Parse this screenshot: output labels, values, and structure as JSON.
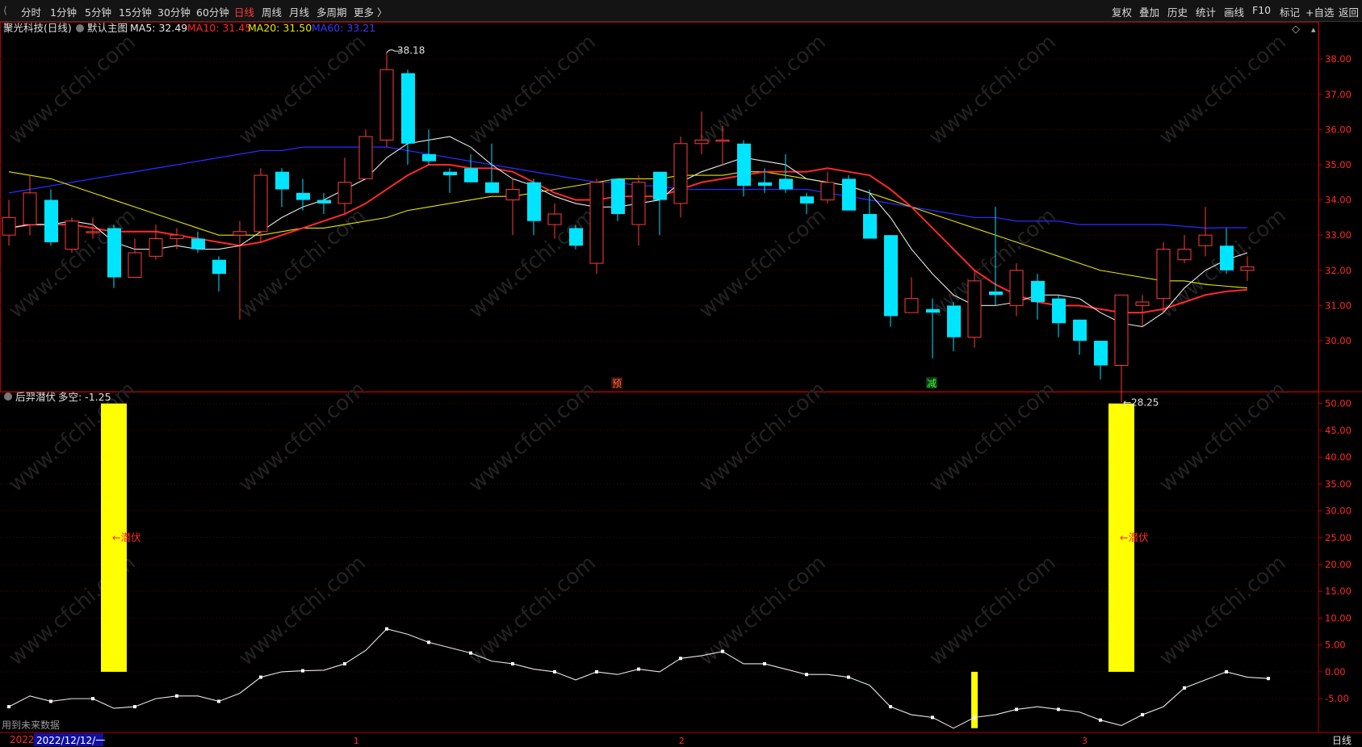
{
  "topbar": {
    "back_label": "⟨",
    "periods": [
      "分时",
      "1分钟",
      "5分钟",
      "15分钟",
      "30分钟",
      "60分钟",
      "日线",
      "周线",
      "月线",
      "多周期",
      "更多 〉"
    ],
    "active_period": "日线",
    "tools": [
      "复权",
      "叠加",
      "历史",
      "统计",
      "画线",
      "F10",
      "+自选",
      "返回"
    ],
    "tools_extra": "标记"
  },
  "colors": {
    "up": "#ff3b3b",
    "down": "#00e5ff",
    "ma5": "#e8e8e8",
    "ma10": "#ff2a2a",
    "ma20": "#e6e600",
    "ma60": "#2a2aff",
    "signal": "#ffff00",
    "grid": "#5a0000",
    "axis": "#b00000"
  },
  "main_panel": {
    "stock_name": "聚光科技(日线)",
    "template_label": "默认主图",
    "ma5_label": "MA5: 32.49",
    "ma10_label": "MA10: 31.45",
    "ma20_label": "MA20: 31.50",
    "ma60_label": "MA60: 33.21",
    "high_label": "38.18",
    "low_label": "←28.25",
    "marker_yu": "预",
    "marker_jian": "减",
    "diamond_icon": "◇"
  },
  "sub_panel": {
    "indicator_label": "后羿潜伏",
    "value_label": "多空: -1.25",
    "signal_text_1": "←潜伏",
    "signal_text_2": "←潜伏",
    "footer_note": "用到未来数据"
  },
  "xaxis": {
    "cursor_date": "2022/12/12/一",
    "left_clip": "2022",
    "month_labels": [
      "1",
      "2",
      "3"
    ],
    "period_button": "日线"
  },
  "chart_data": [
    {
      "type": "candlestick",
      "ylim": [
        28.6,
        38.6
      ],
      "y_ticks": [
        30.0,
        31.0,
        32.0,
        33.0,
        34.0,
        35.0,
        36.0,
        37.0,
        38.0
      ],
      "candles": [
        {
          "o": 33.0,
          "c": 33.5,
          "h": 34.0,
          "l": 32.7
        },
        {
          "o": 33.3,
          "c": 34.2,
          "h": 34.7,
          "l": 33.0
        },
        {
          "o": 34.0,
          "c": 32.8,
          "h": 34.3,
          "l": 32.7
        },
        {
          "o": 32.6,
          "c": 33.4,
          "h": 33.5,
          "l": 32.5
        },
        {
          "o": 33.1,
          "c": 33.1,
          "h": 33.5,
          "l": 32.9
        },
        {
          "o": 33.2,
          "c": 31.8,
          "h": 33.3,
          "l": 31.5
        },
        {
          "o": 31.8,
          "c": 32.5,
          "h": 32.9,
          "l": 31.8
        },
        {
          "o": 32.4,
          "c": 32.9,
          "h": 33.3,
          "l": 32.3
        },
        {
          "o": 32.9,
          "c": 33.0,
          "h": 33.2,
          "l": 32.6
        },
        {
          "o": 32.9,
          "c": 32.6,
          "h": 33.1,
          "l": 32.5
        },
        {
          "o": 32.3,
          "c": 31.9,
          "h": 32.4,
          "l": 31.4
        },
        {
          "o": 33.0,
          "c": 33.1,
          "h": 33.4,
          "l": 30.6
        },
        {
          "o": 33.1,
          "c": 34.7,
          "h": 34.9,
          "l": 32.8
        },
        {
          "o": 34.8,
          "c": 34.3,
          "h": 34.9,
          "l": 33.8
        },
        {
          "o": 34.2,
          "c": 34.0,
          "h": 34.6,
          "l": 33.7
        },
        {
          "o": 34.0,
          "c": 33.9,
          "h": 34.2,
          "l": 33.6
        },
        {
          "o": 33.9,
          "c": 34.5,
          "h": 35.2,
          "l": 33.6
        },
        {
          "o": 34.6,
          "c": 35.8,
          "h": 36.0,
          "l": 34.6
        },
        {
          "o": 35.7,
          "c": 37.7,
          "h": 38.2,
          "l": 35.5
        },
        {
          "o": 37.6,
          "c": 35.6,
          "h": 37.7,
          "l": 35.0
        },
        {
          "o": 35.3,
          "c": 35.1,
          "h": 36.0,
          "l": 35.0
        },
        {
          "o": 34.8,
          "c": 34.7,
          "h": 34.9,
          "l": 34.2
        },
        {
          "o": 34.9,
          "c": 34.5,
          "h": 35.3,
          "l": 34.5
        },
        {
          "o": 34.5,
          "c": 34.2,
          "h": 35.6,
          "l": 34.2
        },
        {
          "o": 34.0,
          "c": 34.3,
          "h": 34.6,
          "l": 33.0
        },
        {
          "o": 34.5,
          "c": 33.4,
          "h": 34.6,
          "l": 33.0
        },
        {
          "o": 33.3,
          "c": 33.6,
          "h": 33.9,
          "l": 32.9
        },
        {
          "o": 33.2,
          "c": 32.7,
          "h": 33.3,
          "l": 32.6
        },
        {
          "o": 32.2,
          "c": 34.5,
          "h": 34.6,
          "l": 31.9
        },
        {
          "o": 34.6,
          "c": 33.6,
          "h": 34.6,
          "l": 33.4
        },
        {
          "o": 33.3,
          "c": 34.5,
          "h": 34.7,
          "l": 32.7
        },
        {
          "o": 34.8,
          "c": 34.0,
          "h": 34.8,
          "l": 33.0
        },
        {
          "o": 33.9,
          "c": 35.6,
          "h": 35.8,
          "l": 33.5
        },
        {
          "o": 35.6,
          "c": 35.7,
          "h": 36.5,
          "l": 35.3
        },
        {
          "o": 35.7,
          "c": 35.7,
          "h": 36.1,
          "l": 35.0
        },
        {
          "o": 35.6,
          "c": 34.4,
          "h": 35.7,
          "l": 34.1
        },
        {
          "o": 34.5,
          "c": 34.4,
          "h": 34.9,
          "l": 34.2
        },
        {
          "o": 34.6,
          "c": 34.3,
          "h": 35.3,
          "l": 34.2
        },
        {
          "o": 34.1,
          "c": 33.9,
          "h": 34.2,
          "l": 33.6
        },
        {
          "o": 34.0,
          "c": 34.5,
          "h": 34.8,
          "l": 33.9
        },
        {
          "o": 34.6,
          "c": 33.7,
          "h": 34.7,
          "l": 33.7
        },
        {
          "o": 33.6,
          "c": 32.9,
          "h": 34.3,
          "l": 32.9
        },
        {
          "o": 33.0,
          "c": 30.7,
          "h": 33.0,
          "l": 30.4
        },
        {
          "o": 30.8,
          "c": 31.2,
          "h": 31.8,
          "l": 30.9
        },
        {
          "o": 30.9,
          "c": 30.8,
          "h": 31.2,
          "l": 29.5
        },
        {
          "o": 31.0,
          "c": 30.1,
          "h": 31.1,
          "l": 29.7
        },
        {
          "o": 30.1,
          "c": 31.7,
          "h": 32.0,
          "l": 29.8
        },
        {
          "o": 31.4,
          "c": 31.3,
          "h": 33.8,
          "l": 31.0
        },
        {
          "o": 31.0,
          "c": 32.0,
          "h": 32.2,
          "l": 30.7
        },
        {
          "o": 31.7,
          "c": 31.1,
          "h": 31.9,
          "l": 30.6
        },
        {
          "o": 31.2,
          "c": 30.5,
          "h": 31.3,
          "l": 30.1
        },
        {
          "o": 30.6,
          "c": 30.0,
          "h": 30.6,
          "l": 29.6
        },
        {
          "o": 30.0,
          "c": 29.3,
          "h": 30.0,
          "l": 28.9
        },
        {
          "o": 29.3,
          "c": 31.3,
          "h": 31.3,
          "l": 28.25
        },
        {
          "o": 31.0,
          "c": 31.1,
          "h": 31.3,
          "l": 30.4
        },
        {
          "o": 31.2,
          "c": 32.6,
          "h": 32.8,
          "l": 30.8
        },
        {
          "o": 32.3,
          "c": 32.6,
          "h": 33.0,
          "l": 32.2
        },
        {
          "o": 32.7,
          "c": 33.0,
          "h": 33.8,
          "l": 32.4
        },
        {
          "o": 32.7,
          "c": 32.0,
          "h": 33.2,
          "l": 31.9
        },
        {
          "o": 32.0,
          "c": 32.1,
          "h": 32.4,
          "l": 31.7
        }
      ],
      "ma5": [
        33.2,
        33.3,
        33.3,
        33.4,
        33.3,
        32.8,
        32.6,
        32.6,
        32.7,
        32.6,
        32.6,
        32.7,
        33.1,
        33.5,
        33.8,
        34.0,
        34.3,
        34.6,
        35.2,
        35.6,
        35.7,
        35.8,
        35.5,
        35.0,
        34.6,
        34.4,
        34.1,
        33.9,
        33.8,
        33.8,
        33.9,
        34.0,
        34.5,
        34.8,
        35.0,
        35.2,
        35.1,
        35.0,
        34.6,
        34.5,
        34.4,
        34.2,
        33.5,
        32.6,
        31.9,
        31.3,
        31.0,
        31.0,
        31.1,
        31.3,
        31.3,
        31.2,
        30.8,
        30.5,
        30.4,
        30.8,
        31.5,
        32.0,
        32.3,
        32.5
      ],
      "ma10": [
        33.2,
        33.3,
        33.3,
        33.3,
        33.2,
        33.1,
        33.1,
        33.1,
        33.0,
        32.9,
        32.8,
        32.7,
        32.8,
        33.0,
        33.2,
        33.4,
        33.6,
        33.9,
        34.3,
        34.7,
        35.0,
        35.0,
        34.9,
        34.9,
        34.8,
        34.5,
        34.2,
        34.0,
        34.0,
        34.1,
        34.1,
        34.1,
        34.3,
        34.5,
        34.6,
        34.7,
        34.8,
        34.8,
        34.8,
        34.9,
        34.8,
        34.7,
        34.3,
        33.8,
        33.2,
        32.6,
        32.0,
        31.6,
        31.3,
        31.1,
        31.0,
        31.0,
        30.9,
        30.8,
        30.8,
        30.9,
        31.1,
        31.3,
        31.4,
        31.45
      ],
      "ma20": [
        34.8,
        34.7,
        34.6,
        34.4,
        34.2,
        34.0,
        33.8,
        33.6,
        33.4,
        33.2,
        33.0,
        33.0,
        33.0,
        33.1,
        33.2,
        33.2,
        33.3,
        33.4,
        33.5,
        33.7,
        33.8,
        33.9,
        34.0,
        34.1,
        34.1,
        34.2,
        34.3,
        34.4,
        34.5,
        34.6,
        34.6,
        34.6,
        34.7,
        34.7,
        34.7,
        34.8,
        34.8,
        34.7,
        34.6,
        34.5,
        34.4,
        34.2,
        34.0,
        33.8,
        33.6,
        33.4,
        33.2,
        33.0,
        32.8,
        32.6,
        32.4,
        32.2,
        32.0,
        31.9,
        31.8,
        31.7,
        31.7,
        31.6,
        31.55,
        31.5
      ],
      "ma60": [
        34.2,
        34.3,
        34.4,
        34.5,
        34.6,
        34.7,
        34.8,
        34.9,
        35.0,
        35.1,
        35.2,
        35.3,
        35.4,
        35.4,
        35.5,
        35.5,
        35.5,
        35.5,
        35.5,
        35.4,
        35.3,
        35.2,
        35.1,
        35.0,
        34.9,
        34.8,
        34.7,
        34.6,
        34.5,
        34.5,
        34.4,
        34.4,
        34.3,
        34.3,
        34.3,
        34.3,
        34.3,
        34.3,
        34.3,
        34.2,
        34.1,
        34.0,
        33.9,
        33.8,
        33.7,
        33.6,
        33.5,
        33.5,
        33.4,
        33.4,
        33.4,
        33.3,
        33.3,
        33.3,
        33.3,
        33.3,
        33.25,
        33.2,
        33.21,
        33.21
      ],
      "high_point": {
        "value": 38.18,
        "index": 18
      },
      "low_point": {
        "value": 28.25,
        "index": 53
      }
    },
    {
      "type": "line",
      "name": "后羿潜伏",
      "ylim": [
        -11,
        51
      ],
      "y_ticks": [
        -5.0,
        0.0,
        5.0,
        10.0,
        15.0,
        20.0,
        25.0,
        30.0,
        35.0,
        40.0,
        45.0,
        50.0
      ],
      "values": [
        -6.5,
        -4.5,
        -5.5,
        -5.0,
        -5.0,
        -6.8,
        -6.5,
        -5.0,
        -4.5,
        -4.5,
        -5.5,
        -4.0,
        -1.0,
        0.0,
        0.2,
        0.3,
        1.5,
        4.0,
        8.0,
        7.0,
        5.5,
        4.5,
        3.5,
        2.0,
        1.5,
        0.5,
        0.0,
        -1.5,
        0.0,
        -0.5,
        0.5,
        0.0,
        2.5,
        3.0,
        3.8,
        1.5,
        1.5,
        0.5,
        -0.5,
        -0.5,
        -1.0,
        -2.5,
        -6.5,
        -8.0,
        -8.5,
        -10.5,
        -8.5,
        -8.0,
        -7.0,
        -6.5,
        -7.0,
        -7.5,
        -9.0,
        -10.0,
        -8.0,
        -6.5,
        -3.0,
        -1.5,
        0.0,
        -1.0,
        -1.25
      ],
      "signals": [
        {
          "index": 5,
          "value": 50
        },
        {
          "index": 46,
          "value": -10.5
        },
        {
          "index": 53,
          "value": 50
        }
      ]
    }
  ]
}
